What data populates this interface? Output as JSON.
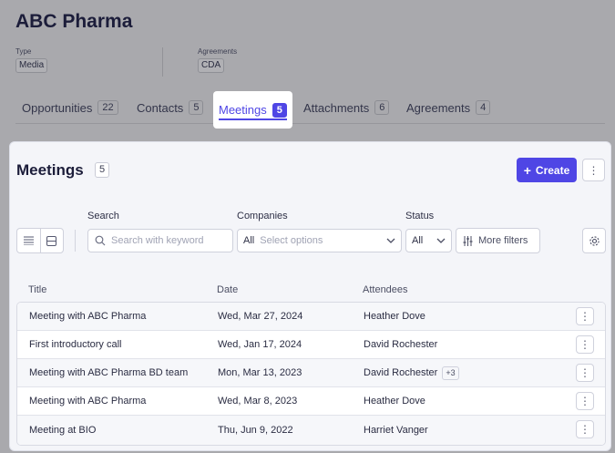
{
  "company": {
    "name": "ABC Pharma",
    "type_label": "Type",
    "type_value": "Media",
    "agreements_label": "Agreements",
    "agreements_value": "CDA"
  },
  "tabs": [
    {
      "label": "Opportunities",
      "count": "22"
    },
    {
      "label": "Contacts",
      "count": "5"
    },
    {
      "label": "Meetings",
      "count": "5",
      "active": true
    },
    {
      "label": "Attachments",
      "count": "6"
    },
    {
      "label": "Agreements",
      "count": "4"
    }
  ],
  "meetings": {
    "title": "Meetings",
    "count": "5",
    "create_label": "Create",
    "filters": {
      "search_label": "Search",
      "search_placeholder": "Search with keyword",
      "companies_label": "Companies",
      "companies_value": "All",
      "companies_placeholder": "Select options",
      "status_label": "Status",
      "status_value": "All",
      "more_filters_label": "More filters"
    },
    "columns": [
      "Title",
      "Date",
      "Attendees"
    ],
    "rows": [
      {
        "title": "Meeting with ABC Pharma",
        "date": "Wed, Mar 27, 2024",
        "attendees": "Heather Dove",
        "extra": ""
      },
      {
        "title": "First introductory call",
        "date": "Wed, Jan 17, 2024",
        "attendees": "David Rochester",
        "extra": ""
      },
      {
        "title": "Meeting with ABC Pharma BD team",
        "date": "Mon, Mar 13, 2023",
        "attendees": "David Rochester",
        "extra": "+3"
      },
      {
        "title": "Meeting with ABC Pharma",
        "date": "Wed, Mar 8, 2023",
        "attendees": "Heather Dove",
        "extra": ""
      },
      {
        "title": "Meeting at BIO",
        "date": "Thu, Jun 9, 2022",
        "attendees": "Harriet Vanger",
        "extra": ""
      }
    ]
  },
  "colors": {
    "accent": "#4f46e5",
    "overlay": "#a9a9ad",
    "panel_bg": "#f4f5f9"
  },
  "icons": {
    "create": "plus-icon",
    "more": "kebab-icon",
    "list_view": "list-view-icon",
    "board_view": "board-view-icon",
    "search": "search-icon",
    "dropdown": "chevron-down-icon",
    "filters": "sliders-icon",
    "settings": "gear-icon"
  }
}
